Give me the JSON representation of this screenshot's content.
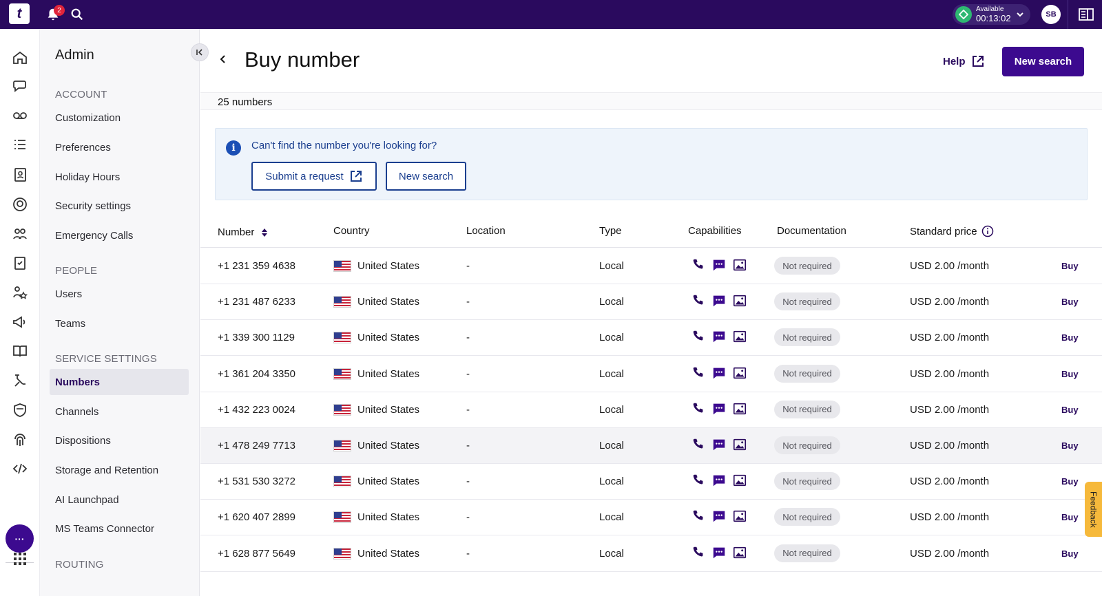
{
  "topbar": {
    "logo_letter": "t",
    "notification_count": "2",
    "status_label": "Available",
    "status_timer": "00:13:02",
    "avatar_initials": "SB"
  },
  "sidenav": {
    "title": "Admin",
    "sections": [
      {
        "label": "ACCOUNT",
        "items": [
          "Customization",
          "Preferences",
          "Holiday Hours",
          "Security settings",
          "Emergency Calls"
        ]
      },
      {
        "label": "PEOPLE",
        "items": [
          "Users",
          "Teams"
        ]
      },
      {
        "label": "SERVICE SETTINGS",
        "items": [
          "Numbers",
          "Channels",
          "Dispositions",
          "Storage and Retention",
          "AI Launchpad",
          "MS Teams Connector"
        ]
      },
      {
        "label": "ROUTING",
        "items": []
      }
    ],
    "active_item": "Numbers"
  },
  "header": {
    "title": "Buy number",
    "help_label": "Help",
    "new_search_label": "New search"
  },
  "results_count": "25 numbers",
  "info_banner": {
    "text": "Can't find the number you're looking for?",
    "submit_label": "Submit a request",
    "new_search_label": "New search"
  },
  "table": {
    "columns": [
      "Number",
      "Country",
      "Location",
      "Type",
      "Capabilities",
      "Documentation",
      "Standard price"
    ],
    "rows": [
      {
        "number": "+1 231 359 4638",
        "country": "United States",
        "location": "-",
        "type": "Local",
        "documentation": "Not required",
        "price": "USD 2.00 /month",
        "action": "Buy"
      },
      {
        "number": "+1 231 487 6233",
        "country": "United States",
        "location": "-",
        "type": "Local",
        "documentation": "Not required",
        "price": "USD 2.00 /month",
        "action": "Buy"
      },
      {
        "number": "+1 339 300 1129",
        "country": "United States",
        "location": "-",
        "type": "Local",
        "documentation": "Not required",
        "price": "USD 2.00 /month",
        "action": "Buy"
      },
      {
        "number": "+1 361 204 3350",
        "country": "United States",
        "location": "-",
        "type": "Local",
        "documentation": "Not required",
        "price": "USD 2.00 /month",
        "action": "Buy"
      },
      {
        "number": "+1 432 223 0024",
        "country": "United States",
        "location": "-",
        "type": "Local",
        "documentation": "Not required",
        "price": "USD 2.00 /month",
        "action": "Buy"
      },
      {
        "number": "+1 478 249 7713",
        "country": "United States",
        "location": "-",
        "type": "Local",
        "documentation": "Not required",
        "price": "USD 2.00 /month",
        "action": "Buy"
      },
      {
        "number": "+1 531 530 3272",
        "country": "United States",
        "location": "-",
        "type": "Local",
        "documentation": "Not required",
        "price": "USD 2.00 /month",
        "action": "Buy"
      },
      {
        "number": "+1 620 407 2899",
        "country": "United States",
        "location": "-",
        "type": "Local",
        "documentation": "Not required",
        "price": "USD 2.00 /month",
        "action": "Buy"
      },
      {
        "number": "+1 628 877 5649",
        "country": "United States",
        "location": "-",
        "type": "Local",
        "documentation": "Not required",
        "price": "USD 2.00 /month",
        "action": "Buy"
      }
    ]
  },
  "feedback_label": "Feedback",
  "colors": {
    "brand": "#2a0a5e",
    "primary_button": "#3c0a8f",
    "info_blue": "#1b3f8f",
    "status_green": "#2eb872",
    "feedback": "#f6b93b"
  }
}
